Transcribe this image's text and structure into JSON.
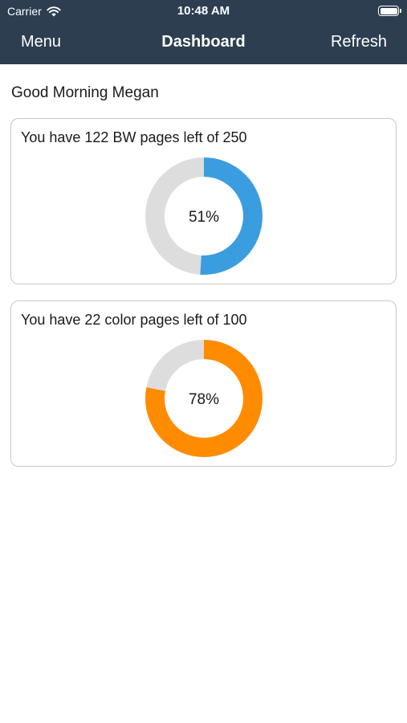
{
  "status_bar": {
    "carrier": "Carrier",
    "time": "10:48 AM",
    "icons": [
      "wifi-icon",
      "battery-icon"
    ]
  },
  "nav": {
    "left_label": "Menu",
    "title": "Dashboard",
    "right_label": "Refresh"
  },
  "greeting": "Good Morning Megan",
  "colors": {
    "navbar_bg": "#2c3e50",
    "ring_track": "#dddddd",
    "bw_accent": "#3a9de0",
    "color_accent": "#ff8c00"
  },
  "cards": [
    {
      "label": "You have 122 BW pages left of 250",
      "percent_label": "51%",
      "fraction": 0.51,
      "color": "#3a9de0"
    },
    {
      "label": "You have 22 color pages left of 100",
      "percent_label": "78%",
      "fraction": 0.78,
      "color": "#ff8c00"
    }
  ]
}
